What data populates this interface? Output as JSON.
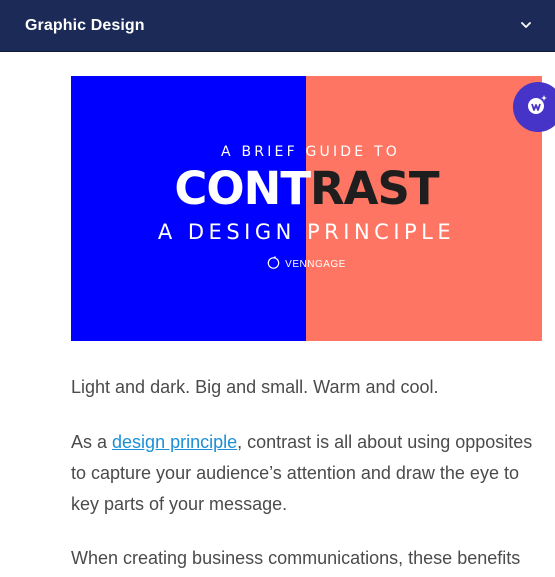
{
  "header": {
    "title": "Graphic Design",
    "toggle_icon": "chevron-down-icon"
  },
  "hero": {
    "subtitle": "A BRIEF GUIDE TO",
    "title_part_1": "CONT",
    "title_part_2": "RAST",
    "tagline": "A DESIGN PRINCIPLE",
    "brand": "VENNGAGE",
    "colors": {
      "left": "#0000ff",
      "right": "#ff7563",
      "dark_text": "#1e1e1e"
    }
  },
  "fab": {
    "icon": "venngage-logo-icon",
    "color": "#4534c7"
  },
  "article": {
    "p1": "Light and dark. Big and small. Warm and cool.",
    "p2_before": "As a ",
    "p2_link": "design principle",
    "p2_after": ", contrast is all about using opposites to capture your audience’s attention and draw the eye to key parts of your message.",
    "p3": "When creating business communications, these benefits"
  }
}
